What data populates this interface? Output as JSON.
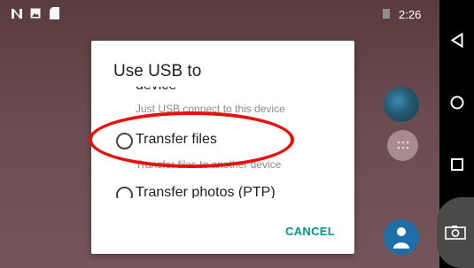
{
  "status_bar": {
    "notification_icons": [
      "n-icon",
      "image-icon",
      "sd-card-icon"
    ],
    "time": "2:26"
  },
  "dialog": {
    "title": "Use USB to",
    "options": [
      {
        "title": "device",
        "subtitle": "Just USB connect to this device"
      },
      {
        "title": "Transfer files",
        "subtitle": "Transfer files to another device"
      },
      {
        "title": "Transfer photos (PTP)"
      }
    ],
    "cancel_label": "CANCEL"
  },
  "nav_bar": {
    "buttons": [
      "back-icon",
      "home-icon",
      "recents-icon"
    ]
  },
  "colors": {
    "accent": "#009688",
    "highlight_ring": "#e5120f",
    "nav_bar": "#000000"
  }
}
